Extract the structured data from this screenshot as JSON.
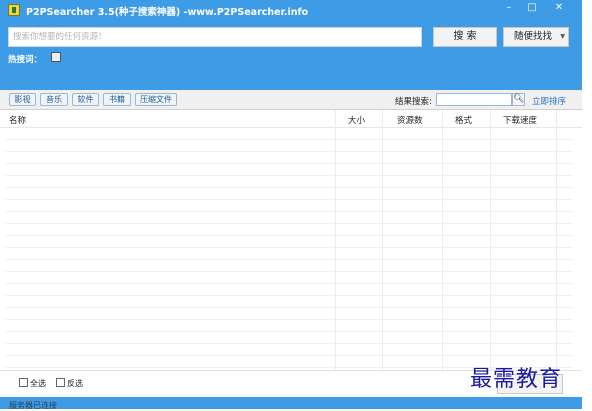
{
  "window": {
    "title": "P2PSearcher 3.5(种子搜索神器) -www.P2PSearcher.info",
    "min_symbol": "–",
    "max_symbol": "□",
    "close_symbol": "✕"
  },
  "search": {
    "placeholder": "搜索你想要的任何资源！",
    "search_button": "搜 索",
    "random_button": "随便找找",
    "hot_label": "热搜词："
  },
  "filters": {
    "categories": [
      "影视",
      "音乐",
      "软件",
      "书籍",
      "压缩文件"
    ],
    "result_label": "结果搜索:",
    "sort_link": "立即排序"
  },
  "table": {
    "columns": [
      "名称",
      "大小",
      "资源数",
      "格式",
      "下载速度"
    ]
  },
  "bottom": {
    "select_all": "全选",
    "invert_select": "反选",
    "watermark": "最需教育",
    "status": "服务器已连接"
  },
  "colors": {
    "accent": "#3e9be6",
    "link": "#2b6fc4"
  }
}
